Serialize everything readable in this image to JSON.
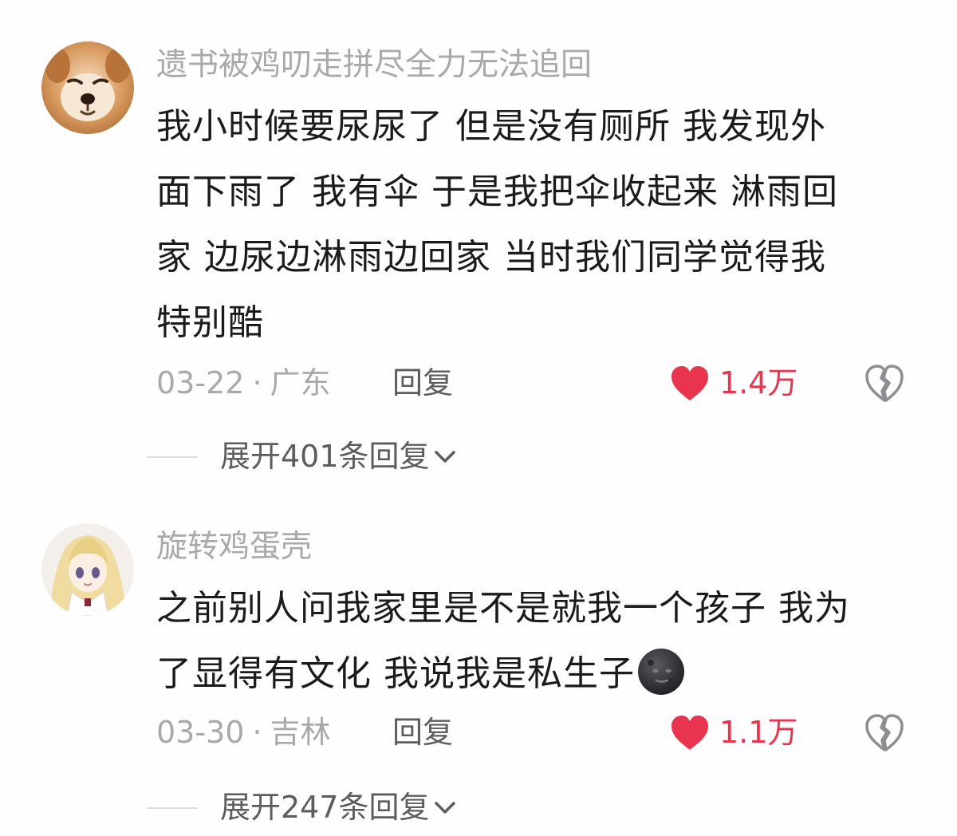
{
  "comments": [
    {
      "username": "遗书被鸡叨走拼尽全力无法追回",
      "text_lines": [
        "我小时候要尿尿了 但是没有厕所 我发现外",
        "面下雨了 我有伞 于是我把伞收起来 淋雨回",
        "家 边尿边淋雨边回家 当时我们同学觉得我",
        "特别酷"
      ],
      "date": "03-22",
      "separator": "·",
      "location": "广东",
      "reply_label": "回复",
      "like_count": "1.4万",
      "liked": true,
      "expand_label": "展开401条回复",
      "avatar": "shiba-dog-avatar"
    },
    {
      "username": "旋转鸡蛋壳",
      "text_lines": [
        "之前别人问我家里是不是就我一个孩子 我为",
        "了显得有文化 我说我是私生子"
      ],
      "trailing_emoji": "new-moon-face-emoji",
      "date": "03-30",
      "separator": "·",
      "location": "吉林",
      "reply_label": "回复",
      "like_count": "1.1万",
      "liked": true,
      "expand_label": "展开247条回复",
      "avatar": "anime-girl-avatar"
    }
  ],
  "colors": {
    "username": "#a9a9ab",
    "text": "#1b1b1b",
    "meta": "#a9a9ab",
    "reply": "#5d5d60",
    "like": "#e8344f",
    "divider": "#dedee0"
  }
}
